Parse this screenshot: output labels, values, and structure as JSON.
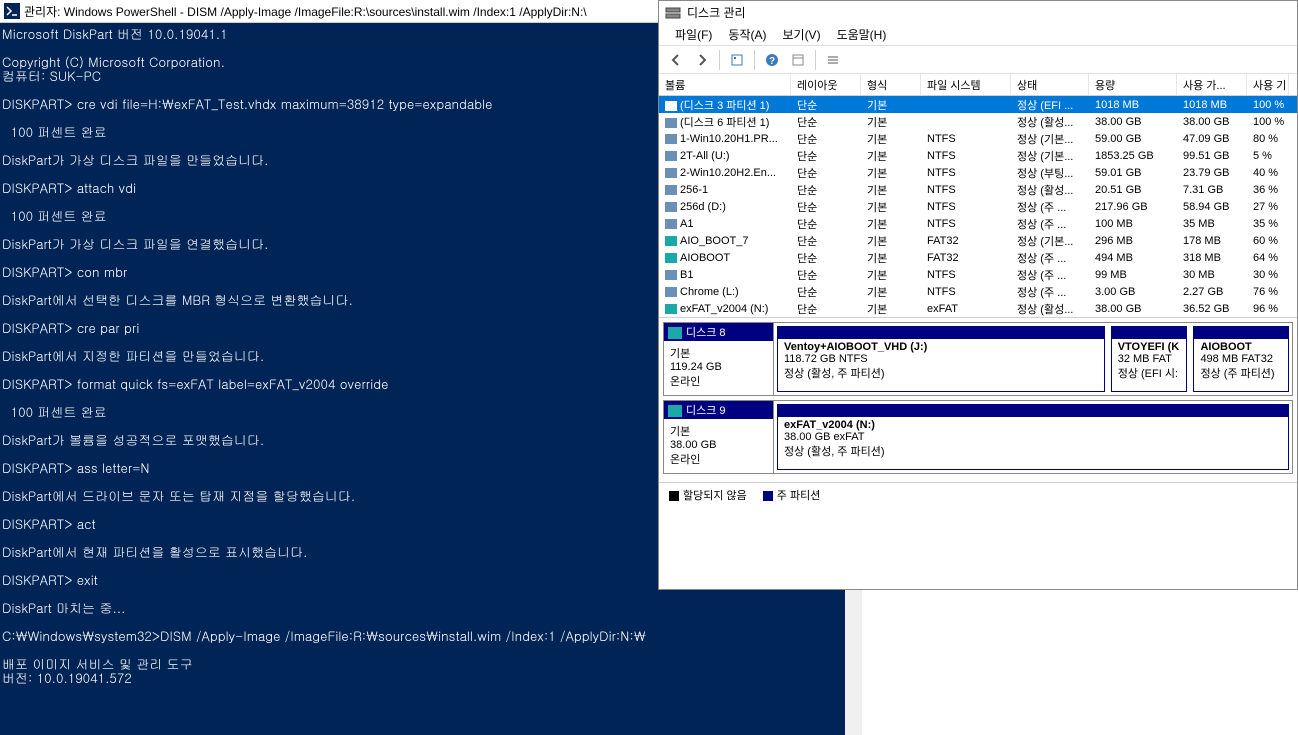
{
  "powershell": {
    "title": "관리자: Windows PowerShell - DISM  /Apply-Image /ImageFile:R:\\sources\\install.wim /Index:1 /ApplyDir:N:\\",
    "lines": [
      "Microsoft DiskPart 버전 10.0.19041.1",
      "",
      "Copyright (C) Microsoft Corporation.",
      "컴퓨터: SUK-PC",
      "",
      "DISKPART> cre vdi file=H:\\exFAT_Test.vhdx maximum=38912 type=expandable",
      "",
      "  100 퍼센트 완료",
      "",
      "DiskPart가 가상 디스크 파일을 만들었습니다.",
      "",
      "DISKPART> attach vdi",
      "",
      "  100 퍼센트 완료",
      "",
      "DiskPart가 가상 디스크 파일을 연결했습니다.",
      "",
      "DISKPART> con mbr",
      "",
      "DiskPart에서 선택한 디스크를 MBR 형식으로 변환했습니다.",
      "",
      "DISKPART> cre par pri",
      "",
      "DiskPart에서 지정한 파티션을 만들었습니다.",
      "",
      "DISKPART> format quick fs=exFAT label=exFAT_v2004 override",
      "",
      "  100 퍼센트 완료",
      "",
      "DiskPart가 볼륨을 성공적으로 포맷했습니다.",
      "",
      "DISKPART> ass letter=N",
      "",
      "DiskPart에서 드라이브 문자 또는 탑재 지점을 할당했습니다.",
      "",
      "DISKPART> act",
      "",
      "DiskPart에서 현재 파티션을 활성으로 표시했습니다.",
      "",
      "DISKPART> exit",
      "",
      "DiskPart 마치는 중...",
      "",
      "C:\\Windows\\system32>DISM /Apply-Image /ImageFile:R:\\sources\\install.wim /Index:1 /ApplyDir:N:\\",
      "",
      "배포 이미지 서비스 및 관리 도구",
      "버전: 10.0.19041.572"
    ]
  },
  "diskmgmt": {
    "title": "디스크 관리",
    "menu": [
      "파일(F)",
      "동작(A)",
      "보기(V)",
      "도움말(H)"
    ],
    "columns": {
      "volume": "볼륨",
      "layout": "레이아웃",
      "type": "형식",
      "fs": "파일 시스템",
      "status": "상태",
      "capacity": "용량",
      "free": "사용 가...",
      "pct": "사용 기"
    },
    "rows": [
      {
        "icon": "sel",
        "vol": "(디스크 3 파티션 1)",
        "layout": "단순",
        "type": "기본",
        "fs": "",
        "status": "정상 (EFI ...",
        "cap": "1018 MB",
        "free": "1018 MB",
        "pct": "100 %",
        "selected": true
      },
      {
        "icon": "",
        "vol": "(디스크 6 파티션 1)",
        "layout": "단순",
        "type": "기본",
        "fs": "",
        "status": "정상 (활성...",
        "cap": "38.00 GB",
        "free": "38.00 GB",
        "pct": "100 %"
      },
      {
        "icon": "",
        "vol": "1-Win10.20H1.PR...",
        "layout": "단순",
        "type": "기본",
        "fs": "NTFS",
        "status": "정상 (기본...",
        "cap": "59.00 GB",
        "free": "47.09 GB",
        "pct": "80 %"
      },
      {
        "icon": "",
        "vol": "2T-All (U:)",
        "layout": "단순",
        "type": "기본",
        "fs": "NTFS",
        "status": "정상 (기본...",
        "cap": "1853.25 GB",
        "free": "99.51 GB",
        "pct": "5 %"
      },
      {
        "icon": "",
        "vol": "2-Win10.20H2.En...",
        "layout": "단순",
        "type": "기본",
        "fs": "NTFS",
        "status": "정상 (부팅...",
        "cap": "59.01 GB",
        "free": "23.79 GB",
        "pct": "40 %"
      },
      {
        "icon": "",
        "vol": "256-1",
        "layout": "단순",
        "type": "기본",
        "fs": "NTFS",
        "status": "정상 (활성...",
        "cap": "20.51 GB",
        "free": "7.31 GB",
        "pct": "36 %"
      },
      {
        "icon": "",
        "vol": "256d (D:)",
        "layout": "단순",
        "type": "기본",
        "fs": "NTFS",
        "status": "정상 (주 ...",
        "cap": "217.96 GB",
        "free": "58.94 GB",
        "pct": "27 %"
      },
      {
        "icon": "",
        "vol": "A1",
        "layout": "단순",
        "type": "기본",
        "fs": "NTFS",
        "status": "정상 (주 ...",
        "cap": "100 MB",
        "free": "35 MB",
        "pct": "35 %"
      },
      {
        "icon": "teal",
        "vol": "AIO_BOOT_7",
        "layout": "단순",
        "type": "기본",
        "fs": "FAT32",
        "status": "정상 (기본...",
        "cap": "296 MB",
        "free": "178 MB",
        "pct": "60 %"
      },
      {
        "icon": "teal",
        "vol": "AIOBOOT",
        "layout": "단순",
        "type": "기본",
        "fs": "FAT32",
        "status": "정상 (주 ...",
        "cap": "494 MB",
        "free": "318 MB",
        "pct": "64 %"
      },
      {
        "icon": "",
        "vol": "B1",
        "layout": "단순",
        "type": "기본",
        "fs": "NTFS",
        "status": "정상 (주 ...",
        "cap": "99 MB",
        "free": "30 MB",
        "pct": "30 %"
      },
      {
        "icon": "",
        "vol": "Chrome (L:)",
        "layout": "단순",
        "type": "기본",
        "fs": "NTFS",
        "status": "정상 (주 ...",
        "cap": "3.00 GB",
        "free": "2.27 GB",
        "pct": "76 %"
      },
      {
        "icon": "teal",
        "vol": "exFAT_v2004 (N:)",
        "layout": "단순",
        "type": "기본",
        "fs": "exFAT",
        "status": "정상 (활성...",
        "cap": "38.00 GB",
        "free": "36.52 GB",
        "pct": "96 %"
      }
    ],
    "disks": [
      {
        "name": "디스크 8",
        "type": "기본",
        "size": "119.24 GB",
        "status": "온라인",
        "iconClass": "teal",
        "parts": [
          {
            "name": "Ventoy+AIOBOOT_VHD  (J:)",
            "info": "118.72 GB NTFS",
            "status": "정상 (활성, 주 파티션)",
            "flex": "5"
          },
          {
            "name": "VTOYEFI  (K",
            "info": "32 MB FAT",
            "status": "정상 (EFI 시:",
            "flex": "1"
          },
          {
            "name": "AIOBOOT",
            "info": "498 MB FAT32",
            "status": "정상 (주 파티션)",
            "flex": "1.3"
          }
        ]
      },
      {
        "name": "디스크 9",
        "type": "기본",
        "size": "38.00 GB",
        "status": "온라인",
        "iconClass": "teal",
        "parts": [
          {
            "name": "exFAT_v2004  (N:)",
            "info": "38.00 GB exFAT",
            "status": "정상 (활성, 주 파티션)",
            "flex": "1"
          }
        ]
      }
    ],
    "legend": {
      "unalloc": "할당되지 않음",
      "primary": "주 파티션"
    }
  }
}
